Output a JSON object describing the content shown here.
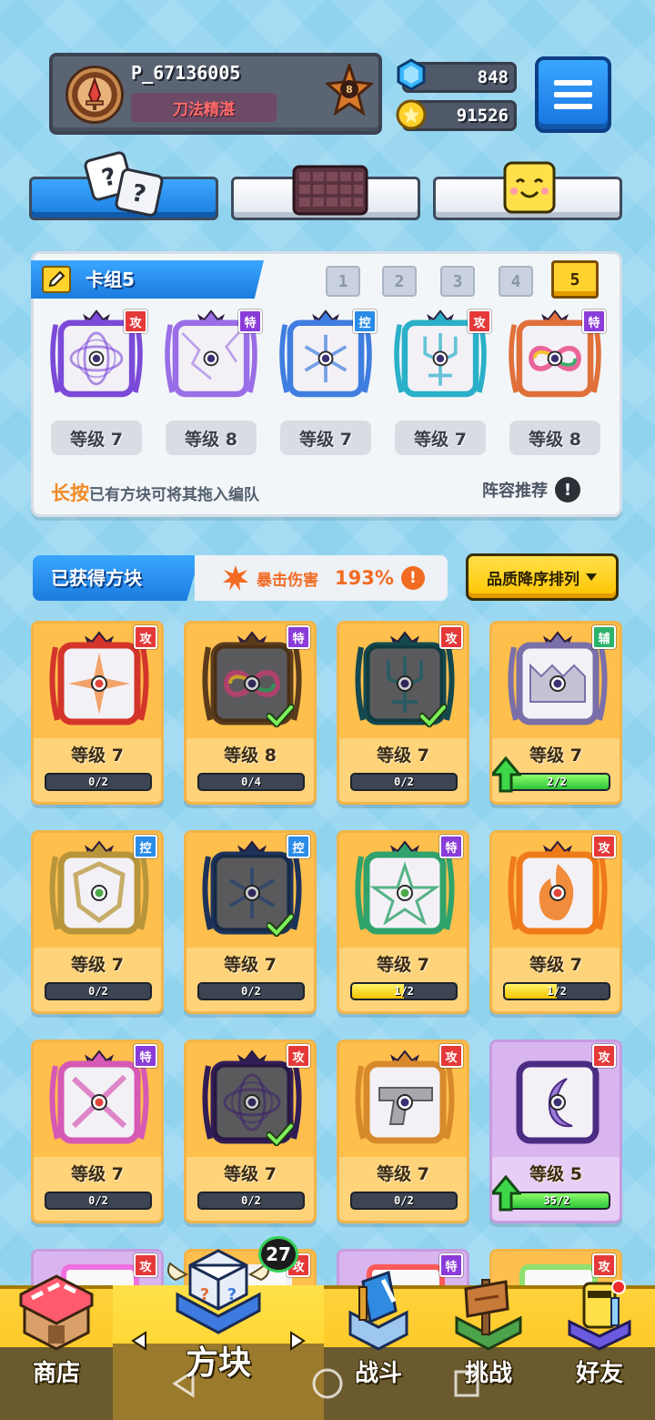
{
  "player": {
    "name": "P_67136005",
    "title": "刀法精湛",
    "rank": "8"
  },
  "currency": {
    "gems": "848",
    "coins": "91526"
  },
  "mode_tabs": [
    "dice-icon",
    "board-icon",
    "smile-icon"
  ],
  "deck": {
    "title": "卡组5",
    "slots": [
      "1",
      "2",
      "3",
      "4",
      "5"
    ],
    "active_slot": "5",
    "cards": [
      {
        "tag": "攻",
        "tag_type": "attack",
        "level": "等级 7",
        "theme": "purple-orbit",
        "color": "#7b4ad8"
      },
      {
        "tag": "特",
        "tag_type": "special",
        "level": "等级 8",
        "theme": "purple-crack",
        "color": "#9a6ee6"
      },
      {
        "tag": "控",
        "tag_type": "control",
        "level": "等级 7",
        "theme": "blue-snowflake",
        "color": "#3f7de0"
      },
      {
        "tag": "攻",
        "tag_type": "attack",
        "level": "等级 7",
        "theme": "teal-trident",
        "color": "#2bb0c9"
      },
      {
        "tag": "特",
        "tag_type": "special",
        "level": "等级 8",
        "theme": "rainbow-infinity",
        "color": "#e0703a"
      }
    ],
    "hint_accent": "长按",
    "hint_text": "已有方块可将其拖入编队",
    "recommend": "阵容推荐",
    "recommend_icon": "!"
  },
  "owned": {
    "title": "已获得方块",
    "crit_label": "暴击伤害",
    "crit_value": "193%",
    "crit_icon": "!",
    "sort_label": "品质降序排列",
    "cards": [
      {
        "tag": "攻",
        "tag_type": "attack",
        "level": "等级 7",
        "progress": "0/2",
        "fraction": 0,
        "theme": "red-star",
        "color": "#d4352b",
        "check": false,
        "upgrade": false,
        "dim": false
      },
      {
        "tag": "特",
        "tag_type": "special",
        "level": "等级 8",
        "progress": "0/4",
        "fraction": 0,
        "theme": "rainbow-infinity",
        "color": "#8b5a2b",
        "check": true,
        "upgrade": false,
        "dim": true
      },
      {
        "tag": "攻",
        "tag_type": "attack",
        "level": "等级 7",
        "progress": "0/2",
        "fraction": 0,
        "theme": "teal-trident",
        "color": "#1f6f7a",
        "check": true,
        "upgrade": false,
        "dim": true
      },
      {
        "tag": "辅",
        "tag_type": "support",
        "level": "等级 7",
        "progress": "2/2",
        "fraction": 1,
        "theme": "gray-monster",
        "color": "#7a6fa8",
        "check": false,
        "upgrade": true,
        "dim": false
      },
      {
        "tag": "控",
        "tag_type": "control",
        "level": "等级 7",
        "progress": "0/2",
        "fraction": 0,
        "theme": "gold-shield",
        "color": "#b8953a",
        "check": false,
        "upgrade": false,
        "dim": false
      },
      {
        "tag": "控",
        "tag_type": "control",
        "level": "等级 7",
        "progress": "0/2",
        "fraction": 0,
        "theme": "blue-snowflake",
        "color": "#2d4f8a",
        "check": true,
        "upgrade": false,
        "dim": true
      },
      {
        "tag": "特",
        "tag_type": "special",
        "level": "等级 7",
        "progress": "1/2",
        "fraction": 0.5,
        "theme": "green-pentagram",
        "color": "#2fa36b",
        "check": false,
        "upgrade": false,
        "dim": false
      },
      {
        "tag": "攻",
        "tag_type": "attack",
        "level": "等级 7",
        "progress": "1/2",
        "fraction": 0.5,
        "theme": "orange-flame",
        "color": "#ef7a1a",
        "check": false,
        "upgrade": false,
        "dim": false
      },
      {
        "tag": "特",
        "tag_type": "special",
        "level": "等级 7",
        "progress": "0/2",
        "fraction": 0,
        "theme": "pink-sword",
        "color": "#d659b5",
        "check": false,
        "upgrade": false,
        "dim": false
      },
      {
        "tag": "攻",
        "tag_type": "attack",
        "level": "等级 7",
        "progress": "0/2",
        "fraction": 0,
        "theme": "purple-orbit",
        "color": "#4b2c82",
        "check": true,
        "upgrade": false,
        "dim": true
      },
      {
        "tag": "攻",
        "tag_type": "attack",
        "level": "等级 7",
        "progress": "0/2",
        "fraction": 0,
        "theme": "gray-gun",
        "color": "#d78a2b",
        "check": false,
        "upgrade": false,
        "dim": false
      },
      {
        "tag": "攻",
        "tag_type": "attack",
        "level": "等级 5",
        "progress": "35/2",
        "fraction": 1,
        "theme": "moon-scythe",
        "color": "#4b2c82",
        "check": false,
        "upgrade": true,
        "dim": false,
        "rarity": "purple"
      }
    ],
    "partial_tags": [
      {
        "tag": "攻",
        "tag_type": "attack"
      },
      {
        "tag": "攻",
        "tag_type": "attack"
      },
      {
        "tag": "特",
        "tag_type": "special"
      },
      {
        "tag": "攻",
        "tag_type": "attack"
      }
    ]
  },
  "nav": {
    "items": [
      {
        "label": "商店",
        "icon": "shop-icon"
      },
      {
        "label": "方块",
        "icon": "dice-cube-icon",
        "active": true
      },
      {
        "label": "战斗",
        "icon": "battle-icon"
      },
      {
        "label": "挑战",
        "icon": "challenge-icon"
      },
      {
        "label": "好友",
        "icon": "friends-icon"
      }
    ],
    "cube_badge": "27"
  }
}
